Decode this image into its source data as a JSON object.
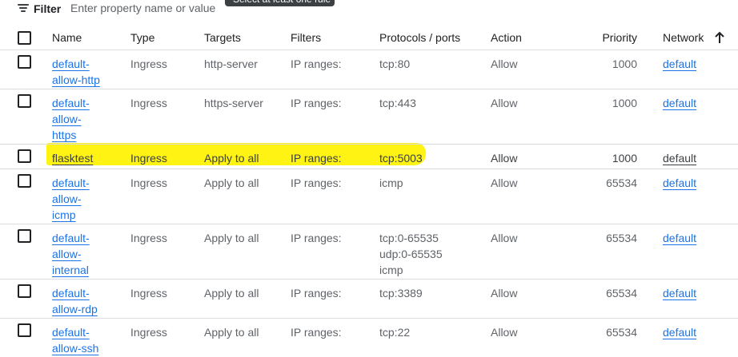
{
  "filter": {
    "label": "Filter",
    "placeholder": "Enter property name or value",
    "tooltip": "Select at least one rule"
  },
  "table": {
    "columns": {
      "name": "Name",
      "type": "Type",
      "targets": "Targets",
      "filters": "Filters",
      "protocols": "Protocols / ports",
      "action": "Action",
      "priority": "Priority",
      "network": "Network"
    },
    "sort": "ascending",
    "rows": [
      {
        "name_lines": [
          "default-",
          "allow-http"
        ],
        "type": "Ingress",
        "targets": "http-server",
        "filters": "IP ranges:",
        "protocols": [
          "tcp:80"
        ],
        "action": "Allow",
        "priority": "1000",
        "network": "default"
      },
      {
        "name_lines": [
          "default-",
          "allow-",
          "https"
        ],
        "type": "Ingress",
        "targets": "https-server",
        "filters": "IP ranges:",
        "protocols": [
          "tcp:443"
        ],
        "action": "Allow",
        "priority": "1000",
        "network": "default"
      },
      {
        "name_lines": [
          "flasktest"
        ],
        "type": "Ingress",
        "targets": "Apply to all",
        "filters": "IP ranges:",
        "protocols": [
          "tcp:5003"
        ],
        "action": "Allow",
        "priority": "1000",
        "network": "default",
        "highlighted": true
      },
      {
        "name_lines": [
          "default-",
          "allow-",
          "icmp"
        ],
        "type": "Ingress",
        "targets": "Apply to all",
        "filters": "IP ranges:",
        "protocols": [
          "icmp"
        ],
        "action": "Allow",
        "priority": "65534",
        "network": "default"
      },
      {
        "name_lines": [
          "default-",
          "allow-",
          "internal"
        ],
        "type": "Ingress",
        "targets": "Apply to all",
        "filters": "IP ranges:",
        "protocols": [
          "tcp:0-65535",
          "udp:0-65535",
          "icmp"
        ],
        "action": "Allow",
        "priority": "65534",
        "network": "default"
      },
      {
        "name_lines": [
          "default-",
          "allow-rdp"
        ],
        "type": "Ingress",
        "targets": "Apply to all",
        "filters": "IP ranges:",
        "protocols": [
          "tcp:3389"
        ],
        "action": "Allow",
        "priority": "65534",
        "network": "default"
      },
      {
        "name_lines": [
          "default-",
          "allow-ssh"
        ],
        "type": "Ingress",
        "targets": "Apply to all",
        "filters": "IP ranges:",
        "protocols": [
          "tcp:22"
        ],
        "action": "Allow",
        "priority": "65534",
        "network": "default"
      }
    ]
  },
  "colors": {
    "link": "#1a73e8",
    "highlight": "#fff200",
    "text": "#5f6368",
    "divider": "#dadce0"
  }
}
